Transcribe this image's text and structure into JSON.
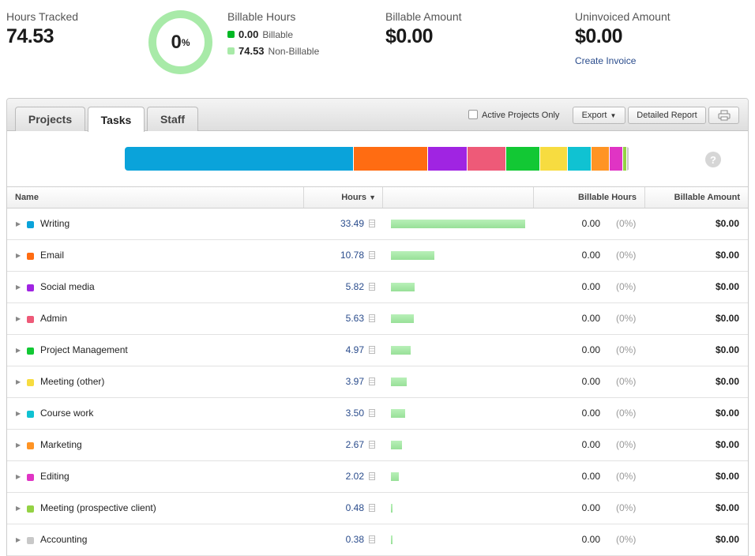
{
  "summary": {
    "hours_tracked_label": "Hours Tracked",
    "hours_tracked": "74.53",
    "donut_percent": "0",
    "donut_percent_sign": "%",
    "billable_fraction": 0,
    "billable_hours_label": "Billable Hours",
    "billable_value": "0.00",
    "billable_text": "Billable",
    "nonbillable_value": "74.53",
    "nonbillable_text": "Non-Billable",
    "billable_amount_label": "Billable Amount",
    "billable_amount": "$0.00",
    "uninvoiced_label": "Uninvoiced Amount",
    "uninvoiced_amount": "$0.00",
    "create_invoice": "Create Invoice",
    "colors": {
      "billable": "#00b824",
      "nonbillable": "#a8eaa8"
    }
  },
  "tabs": [
    {
      "label": "Projects"
    },
    {
      "label": "Tasks",
      "active": true
    },
    {
      "label": "Staff"
    }
  ],
  "toolbar": {
    "active_only": "Active Projects Only",
    "active_only_checked": false,
    "export": "Export",
    "detailed_report": "Detailed Report",
    "print_icon": "printer-icon"
  },
  "help_icon": "?",
  "columns": {
    "name": "Name",
    "hours": "Hours",
    "billable_hours": "Billable Hours",
    "billable_amount": "Billable Amount"
  },
  "rows": [
    {
      "name": "Writing",
      "hours": "33.49",
      "billable_hours": "0.00",
      "pct": "(0%)",
      "amount": "$0.00",
      "color": "#0aa3da"
    },
    {
      "name": "Email",
      "hours": "10.78",
      "billable_hours": "0.00",
      "pct": "(0%)",
      "amount": "$0.00",
      "color": "#ff6c12"
    },
    {
      "name": "Social media",
      "hours": "5.82",
      "billable_hours": "0.00",
      "pct": "(0%)",
      "amount": "$0.00",
      "color": "#a024e2"
    },
    {
      "name": "Admin",
      "hours": "5.63",
      "billable_hours": "0.00",
      "pct": "(0%)",
      "amount": "$0.00",
      "color": "#ee5a78"
    },
    {
      "name": "Project Management",
      "hours": "4.97",
      "billable_hours": "0.00",
      "pct": "(0%)",
      "amount": "$0.00",
      "color": "#12c834"
    },
    {
      "name": "Meeting (other)",
      "hours": "3.97",
      "billable_hours": "0.00",
      "pct": "(0%)",
      "amount": "$0.00",
      "color": "#f7dc40"
    },
    {
      "name": "Course work",
      "hours": "3.50",
      "billable_hours": "0.00",
      "pct": "(0%)",
      "amount": "$0.00",
      "color": "#10c2d2"
    },
    {
      "name": "Marketing",
      "hours": "2.67",
      "billable_hours": "0.00",
      "pct": "(0%)",
      "amount": "$0.00",
      "color": "#ff9424"
    },
    {
      "name": "Editing",
      "hours": "2.02",
      "billable_hours": "0.00",
      "pct": "(0%)",
      "amount": "$0.00",
      "color": "#e034c4"
    },
    {
      "name": "Meeting (prospective client)",
      "hours": "0.48",
      "billable_hours": "0.00",
      "pct": "(0%)",
      "amount": "$0.00",
      "color": "#94d244"
    },
    {
      "name": "Accounting",
      "hours": "0.38",
      "billable_hours": "0.00",
      "pct": "(0%)",
      "amount": "$0.00",
      "color": "#c8c8c8"
    }
  ]
}
